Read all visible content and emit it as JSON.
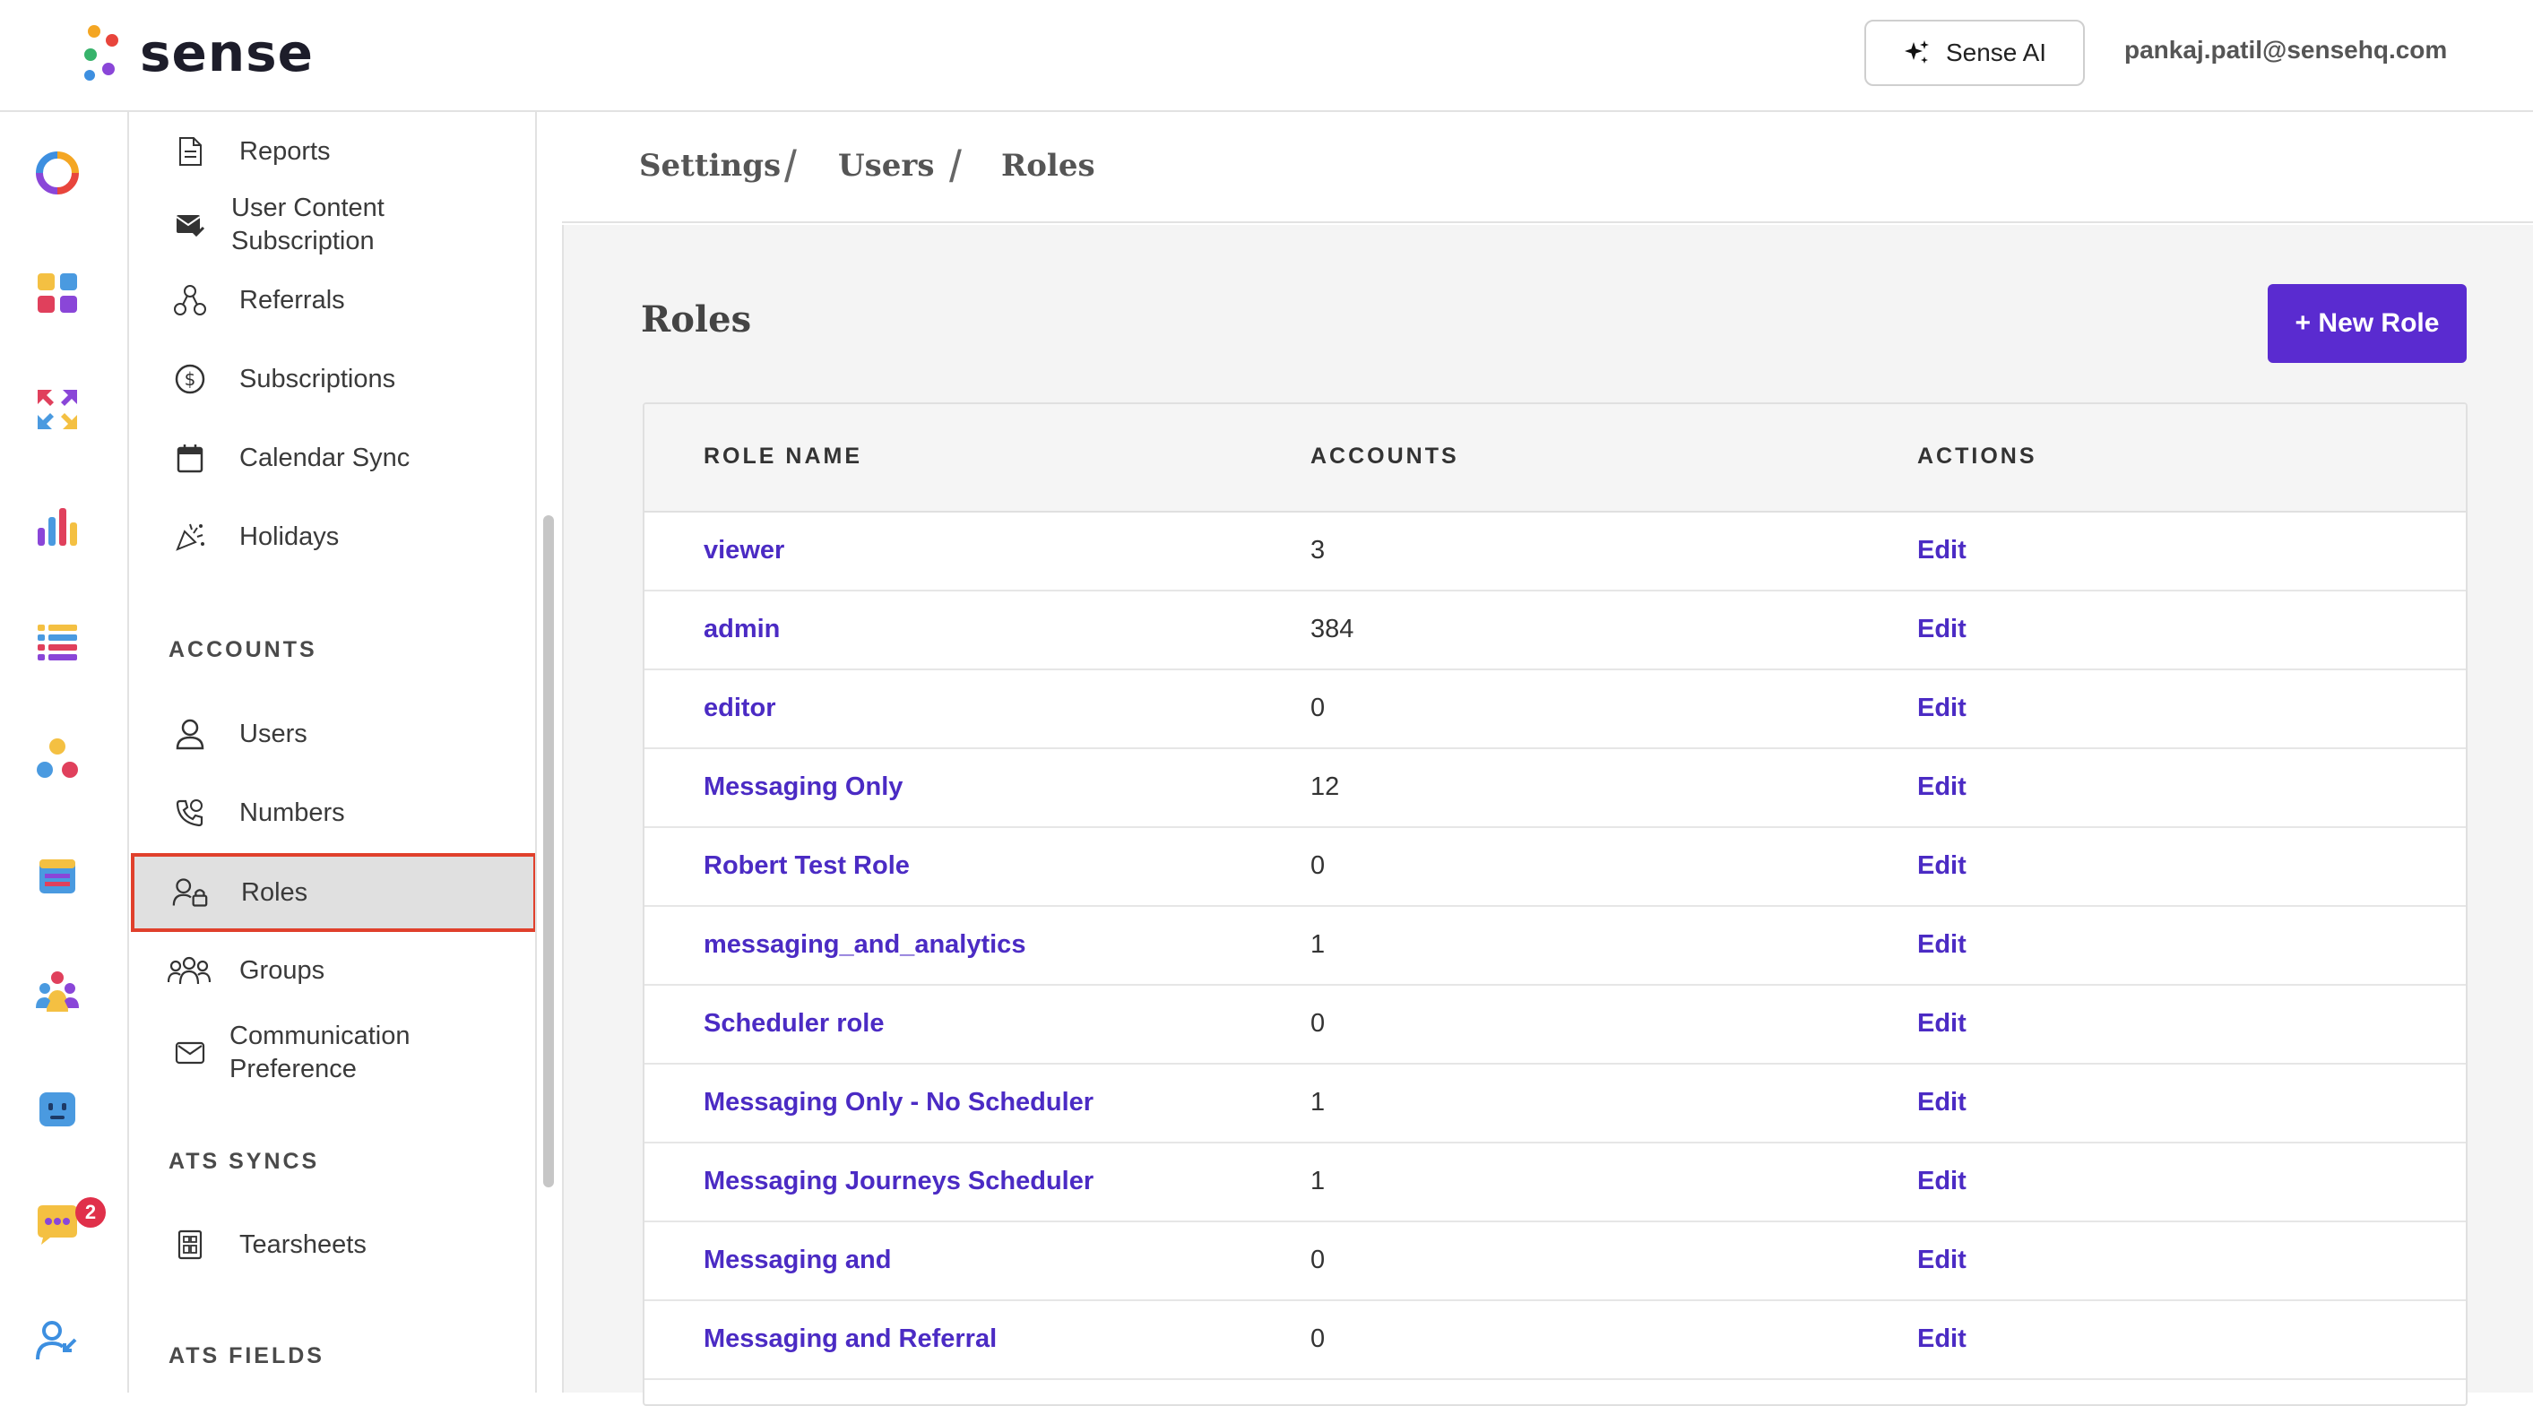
{
  "header": {
    "logo_text": "sense",
    "ai_button_label": "Sense AI",
    "user_email": "pankaj.patil@sensehq.com"
  },
  "rail": {
    "icons": [
      "ring-chart-icon",
      "apps-grid-icon",
      "arrows-exchange-icon",
      "bar-chart-icon",
      "list-icon",
      "people-network-icon",
      "calendar-icon",
      "group-icon",
      "bot-icon",
      "chat-icon",
      "user-arrow-icon"
    ],
    "chat_badge": "2"
  },
  "subnav": {
    "items_top": [
      {
        "label": "Reports",
        "icon": "document-icon"
      },
      {
        "label": "User Content Subscription",
        "icon": "mail-check-icon"
      },
      {
        "label": "Referrals",
        "icon": "referral-icon"
      },
      {
        "label": "Subscriptions",
        "icon": "dollar-circle-icon"
      },
      {
        "label": "Calendar Sync",
        "icon": "calendar-icon"
      },
      {
        "label": "Holidays",
        "icon": "party-icon"
      }
    ],
    "section_accounts": "ACCOUNTS",
    "items_accounts": [
      {
        "label": "Users",
        "icon": "user-icon"
      },
      {
        "label": "Numbers",
        "icon": "phone-icon"
      },
      {
        "label": "Roles",
        "icon": "user-lock-icon"
      },
      {
        "label": "Groups",
        "icon": "group-icon"
      },
      {
        "label": "Communication Preference",
        "icon": "envelope-icon"
      }
    ],
    "section_ats_syncs": "ATS SYNCS",
    "items_ats_syncs": [
      {
        "label": "Tearsheets",
        "icon": "tearsheet-icon"
      }
    ],
    "section_ats_fields": "ATS FIELDS"
  },
  "breadcrumb": [
    "Settings",
    "Users",
    "Roles"
  ],
  "main": {
    "title": "Roles",
    "new_role_label": "+ New Role",
    "columns": [
      "ROLE NAME",
      "ACCOUNTS",
      "ACTIONS"
    ],
    "rows": [
      {
        "name": "viewer",
        "accounts": "3",
        "action": "Edit"
      },
      {
        "name": "admin",
        "accounts": "384",
        "action": "Edit"
      },
      {
        "name": "editor",
        "accounts": "0",
        "action": "Edit"
      },
      {
        "name": "Messaging Only",
        "accounts": "12",
        "action": "Edit"
      },
      {
        "name": "Robert Test Role",
        "accounts": "0",
        "action": "Edit"
      },
      {
        "name": "messaging_and_analytics",
        "accounts": "1",
        "action": "Edit"
      },
      {
        "name": "Scheduler role",
        "accounts": "0",
        "action": "Edit"
      },
      {
        "name": "Messaging Only - No Scheduler",
        "accounts": "1",
        "action": "Edit"
      },
      {
        "name": "Messaging Journeys Scheduler",
        "accounts": "1",
        "action": "Edit"
      },
      {
        "name": "Messaging and",
        "accounts": "0",
        "action": "Edit"
      },
      {
        "name": "Messaging and Referral",
        "accounts": "0",
        "action": "Edit"
      }
    ]
  },
  "colors": {
    "accent": "#5a2bd0",
    "link": "#4b2bc4",
    "active_outline": "#e0402c",
    "badge": "#e0304a"
  }
}
